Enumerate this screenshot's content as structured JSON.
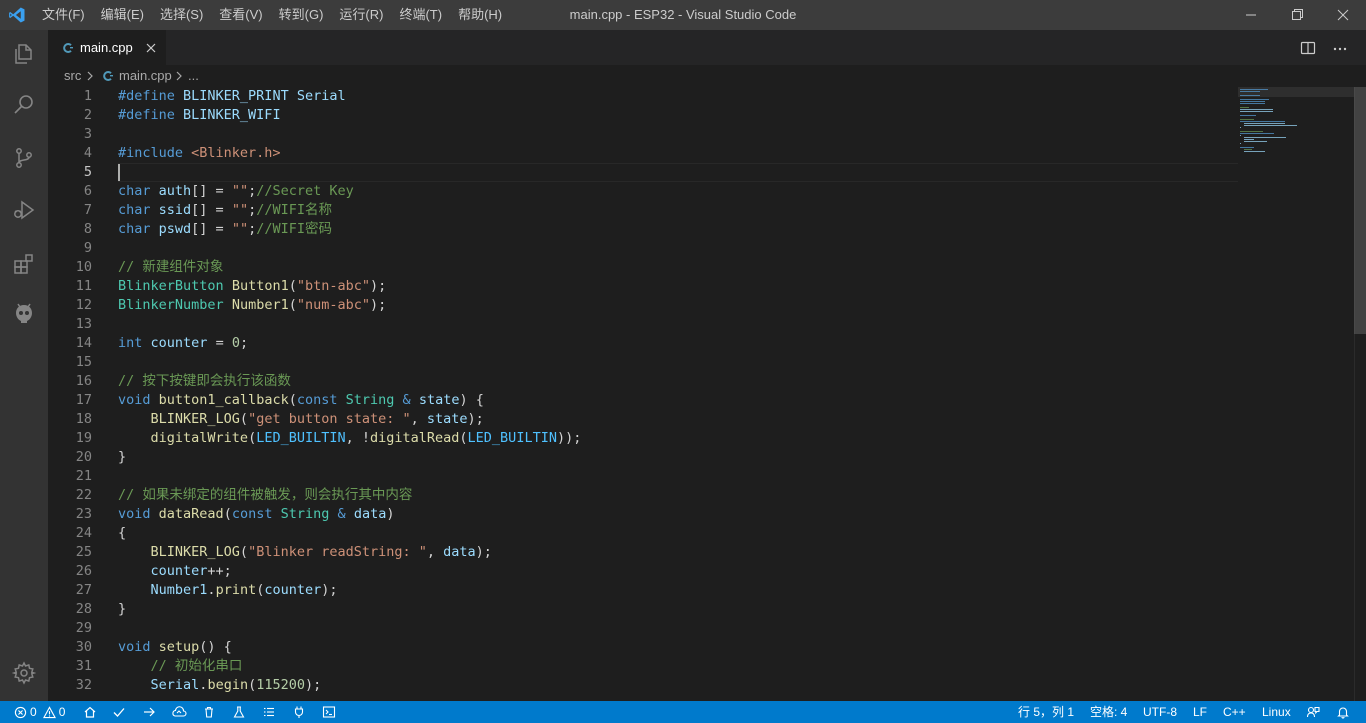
{
  "menu": [
    "文件(F)",
    "编辑(E)",
    "选择(S)",
    "查看(V)",
    "转到(G)",
    "运行(R)",
    "终端(T)",
    "帮助(H)"
  ],
  "window_title": "main.cpp - ESP32 - Visual Studio Code",
  "activity_bar": [
    "explorer-icon",
    "search-icon",
    "source-control-icon",
    "run-debug-icon",
    "extensions-icon",
    "platformio-icon",
    "settings-gear-icon"
  ],
  "tab": {
    "label": "main.cpp",
    "icon": "cpp-file-icon"
  },
  "breadcrumb": {
    "folder": "src",
    "file": "main.cpp",
    "more": "..."
  },
  "editor": {
    "active_line": 5,
    "line_numbers": [
      "1",
      "2",
      "3",
      "4",
      "5",
      "6",
      "7",
      "8",
      "9",
      "10",
      "11",
      "12",
      "13",
      "14",
      "15",
      "16",
      "17",
      "18",
      "19",
      "20",
      "21",
      "22",
      "23",
      "24",
      "25",
      "26",
      "27",
      "28",
      "29",
      "30",
      "31",
      "32"
    ],
    "lines": [
      "#define BLINKER_PRINT Serial",
      "#define BLINKER_WIFI",
      "",
      "#include <Blinker.h>",
      "",
      "char auth[] = \"\";//Secret Key",
      "char ssid[] = \"\";//WIFI名称",
      "char pswd[] = \"\";//WIFI密码",
      "",
      "// 新建组件对象",
      "BlinkerButton Button1(\"btn-abc\");",
      "BlinkerNumber Number1(\"num-abc\");",
      "",
      "int counter = 0;",
      "",
      "// 按下按键即会执行该函数",
      "void button1_callback(const String & state) {",
      "    BLINKER_LOG(\"get button state: \", state);",
      "    digitalWrite(LED_BUILTIN, !digitalRead(LED_BUILTIN));",
      "}",
      "",
      "// 如果未绑定的组件被触发，则会执行其中内容",
      "void dataRead(const String & data)",
      "{",
      "    BLINKER_LOG(\"Blinker readString: \", data);",
      "    counter++;",
      "    Number1.print(counter);",
      "}",
      "",
      "void setup() {",
      "    // 初始化串口",
      "    Serial.begin(115200);"
    ]
  },
  "status": {
    "errors": "0",
    "warnings": "0",
    "position": "行 5，列 1",
    "spaces": "空格: 4",
    "encoding": "UTF-8",
    "eol": "LF",
    "language": "C++",
    "platform": "Linux"
  },
  "colors": {
    "status_bar": "#007acc",
    "title_bar": "#3c3c3c",
    "activity_bar": "#333333",
    "editor_bg": "#1e1e1e"
  }
}
